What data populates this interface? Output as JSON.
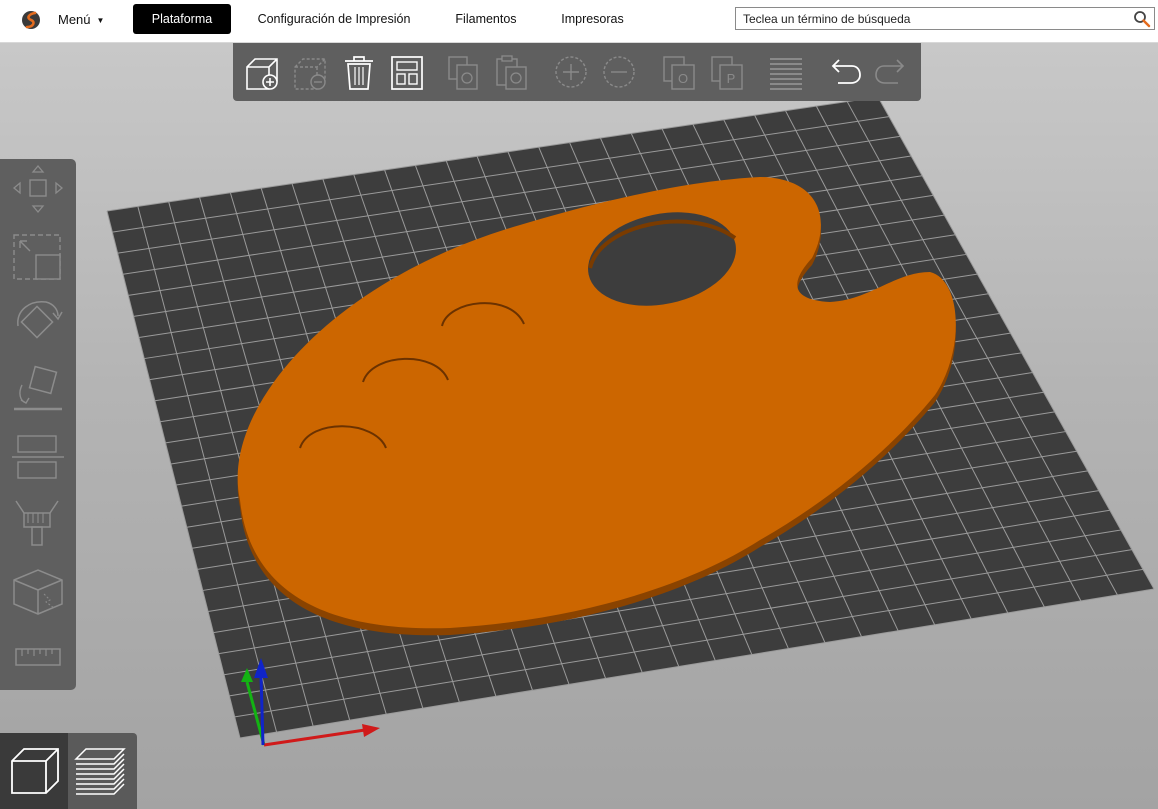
{
  "app": {
    "menu_label": "Menú",
    "tabs": [
      {
        "label": "Plataforma",
        "active": true
      },
      {
        "label": "Configuración de Impresión",
        "active": false
      },
      {
        "label": "Filamentos",
        "active": false
      },
      {
        "label": "Impresoras",
        "active": false
      }
    ],
    "search": {
      "placeholder": "Teclea un término de búsqueda",
      "value": ""
    }
  },
  "toolbar": {
    "tools": [
      {
        "icon": "add-object-icon",
        "enabled": true
      },
      {
        "icon": "delete-object-icon",
        "enabled": false
      },
      {
        "icon": "delete-all-icon",
        "enabled": true
      },
      {
        "icon": "arrange-icon",
        "enabled": true
      },
      {
        "icon": "copy-icon",
        "enabled": false
      },
      {
        "icon": "paste-icon",
        "enabled": false
      },
      {
        "icon": "add-instance-icon",
        "enabled": false
      },
      {
        "icon": "remove-instance-icon",
        "enabled": false
      },
      {
        "icon": "split-objects-icon",
        "enabled": false
      },
      {
        "icon": "split-parts-icon",
        "enabled": false
      },
      {
        "icon": "layers-editing-icon",
        "enabled": false
      },
      {
        "icon": "undo-icon",
        "enabled": true
      },
      {
        "icon": "redo-icon",
        "enabled": false
      }
    ]
  },
  "left_tools": [
    {
      "icon": "move-icon"
    },
    {
      "icon": "scale-icon"
    },
    {
      "icon": "rotate-icon"
    },
    {
      "icon": "place-on-face-icon"
    },
    {
      "icon": "cut-icon"
    },
    {
      "icon": "paint-supports-icon"
    },
    {
      "icon": "seam-painting-icon"
    },
    {
      "icon": "measure-icon"
    }
  ],
  "view_modes": [
    {
      "icon": "3d-view-icon",
      "active": true
    },
    {
      "icon": "preview-layers-icon",
      "active": false
    }
  ],
  "colors": {
    "model": "#cc6600",
    "model_edge": "#8a4300",
    "bed": "#3d3d3d",
    "grid": "#9a9a9a",
    "accent_active_tab": "#000000"
  }
}
